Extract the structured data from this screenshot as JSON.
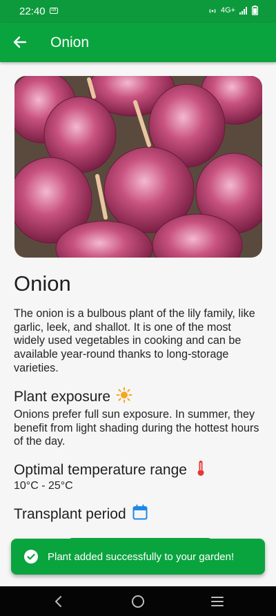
{
  "status_bar": {
    "time": "22:40",
    "chip": "GB",
    "network": "4G+"
  },
  "app_bar": {
    "title": "Onion",
    "back_icon": "arrow-left-icon"
  },
  "plant": {
    "name": "Onion",
    "description": "The onion is a bulbous plant of the lily family, like garlic, leek, and shallot. It is one of the most widely used vegetables in cooking and can be available year-round thanks to long-storage varieties.",
    "exposure_title": "Plant exposure",
    "exposure_icon": "sun-icon",
    "exposure_text": "Onions prefer full sun exposure. In summer, they benefit from light shading during the hottest hours of the day.",
    "temperature_title": "Optimal temperature range",
    "temperature_icon": "thermometer-icon",
    "temperature_text": "10°C - 25°C",
    "transplant_title": "Transplant period",
    "transplant_icon": "calendar-icon"
  },
  "snackbar": {
    "message": "Plant added successfully to your garden!",
    "icon": "check-circle-icon"
  },
  "nav": {
    "back": "nav-back-icon",
    "home": "nav-home-icon",
    "menu": "nav-menu-icon"
  },
  "colors": {
    "primary": "#0aa43e",
    "status_bar": "#0d9a3c",
    "sun": "#f5a623",
    "thermometer": "#e53935",
    "calendar": "#1e88e5"
  }
}
